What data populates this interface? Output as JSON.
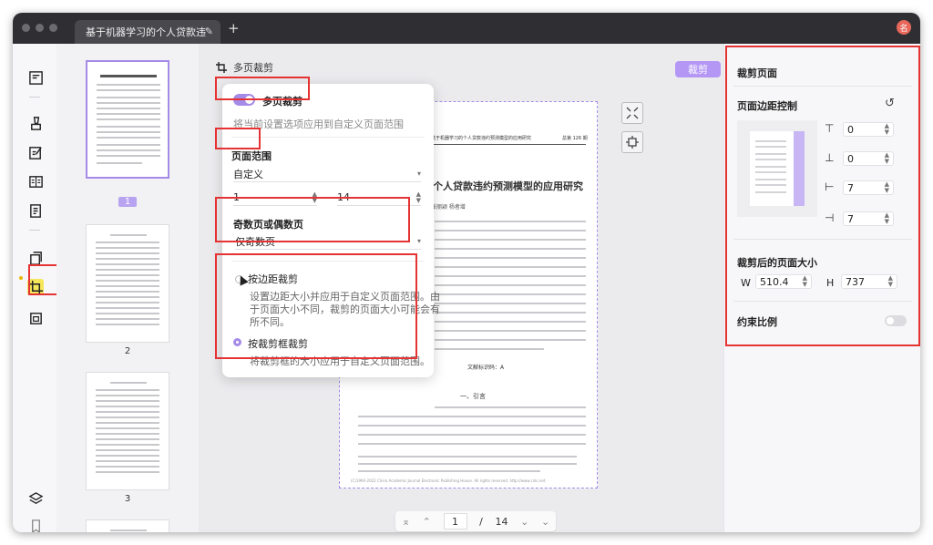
{
  "titlebar": {
    "tab_title": "基于机器学习的个人贷款违",
    "new_tab": "+",
    "avatar_text": "名"
  },
  "toolbar": {
    "mode_label": "多页裁剪",
    "crop_button": "裁剪"
  },
  "thumbnails": [
    {
      "label": "1",
      "selected": true
    },
    {
      "label": "2",
      "selected": false
    },
    {
      "label": "3",
      "selected": false
    }
  ],
  "document": {
    "header_left": "基于机器学习的个人贷款违约预测模型的应用研究",
    "header_right": "总第 126 期",
    "title": "个人贷款违约预测模型的应用研究",
    "authors": "张丽颖    杨者增",
    "doc_code": "文献标识码：A",
    "section": "一、引言",
    "footer": "(C)1994-2022 China Academic Journal Electronic Publishing House. All rights reserved.    http://www.cnki.net"
  },
  "pager": {
    "current": "1",
    "separator": "/",
    "total": "14"
  },
  "popup": {
    "multi_crop_label": "多页裁剪",
    "multi_crop_desc": "将当前设置选项应用到自定义页面范围",
    "range_label": "页面范围",
    "range_select": "自定义",
    "range_from": "1",
    "range_dash": "—",
    "range_to": "14",
    "odd_even_label": "奇数页或偶数页",
    "odd_even_select": "仅奇数页",
    "by_margin_label": "按边距裁剪",
    "by_margin_desc_1": "设置边距大小并应用于自定义页面范围。由",
    "by_margin_desc_2": "于页面大小不同，裁剪的页面大小可能会有",
    "by_margin_desc_3": "所不同。",
    "by_box_label": "按裁剪框裁剪",
    "by_box_desc": "将裁剪框的大小应用于自定义页面范围。"
  },
  "right_panel": {
    "title": "裁剪页面",
    "margin_control": "页面边距控制",
    "margins": {
      "top": "0",
      "bottom": "0",
      "left": "7",
      "right": "7"
    },
    "cropped_size_label": "裁剪后的页面大小",
    "w_label": "W",
    "w_value": "510.4",
    "h_label": "H",
    "h_value": "737",
    "constrain_label": "约束比例"
  },
  "colors": {
    "accent": "#a58be8",
    "button": "#b497f5",
    "highlight": "#e53333",
    "titlebar": "#2f2f33"
  }
}
